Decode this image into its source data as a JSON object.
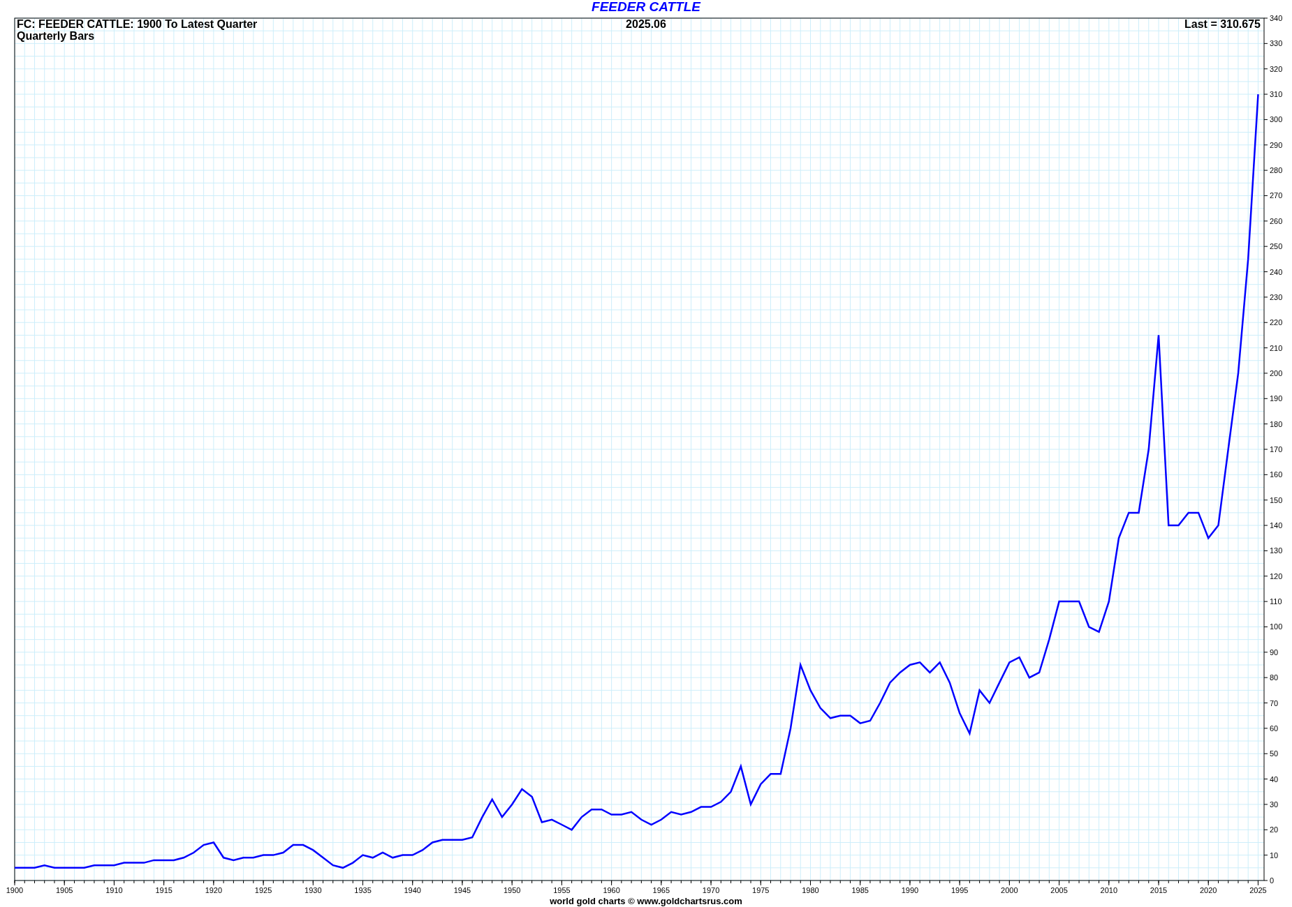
{
  "title": "FEEDER CATTLE",
  "header": {
    "left_lines": [
      "FC: FEEDER CATTLE: 1900 To Latest Quarter",
      "Quarterly Bars"
    ],
    "center": "2025.06",
    "right": "Last = 310.675"
  },
  "chart_data": {
    "type": "line",
    "x": [
      1900,
      1901,
      1902,
      1903,
      1904,
      1905,
      1906,
      1907,
      1908,
      1909,
      1910,
      1911,
      1912,
      1913,
      1914,
      1915,
      1916,
      1917,
      1918,
      1919,
      1920,
      1921,
      1922,
      1923,
      1924,
      1925,
      1926,
      1927,
      1928,
      1929,
      1930,
      1931,
      1932,
      1933,
      1934,
      1935,
      1936,
      1937,
      1938,
      1939,
      1940,
      1941,
      1942,
      1943,
      1944,
      1945,
      1946,
      1947,
      1948,
      1949,
      1950,
      1951,
      1952,
      1953,
      1954,
      1955,
      1956,
      1957,
      1958,
      1959,
      1960,
      1961,
      1962,
      1963,
      1964,
      1965,
      1966,
      1967,
      1968,
      1969,
      1970,
      1971,
      1972,
      1973,
      1974,
      1975,
      1976,
      1977,
      1978,
      1979,
      1980,
      1981,
      1982,
      1983,
      1984,
      1985,
      1986,
      1987,
      1988,
      1989,
      1990,
      1991,
      1992,
      1993,
      1994,
      1995,
      1996,
      1997,
      1998,
      1999,
      2000,
      2001,
      2002,
      2003,
      2004,
      2005,
      2006,
      2007,
      2008,
      2009,
      2010,
      2011,
      2012,
      2013,
      2014,
      2015,
      2016,
      2017,
      2018,
      2019,
      2020,
      2021,
      2022,
      2023,
      2024,
      2025
    ],
    "grid": true,
    "series": [
      {
        "color": "#0000ff",
        "values": [
          5,
          5,
          5,
          6,
          5,
          5,
          5,
          5,
          6,
          6,
          6,
          7,
          7,
          7,
          8,
          8,
          8,
          9,
          11,
          14,
          15,
          9,
          8,
          9,
          9,
          10,
          10,
          11,
          14,
          14,
          12,
          9,
          6,
          5,
          7,
          10,
          9,
          11,
          9,
          10,
          10,
          12,
          15,
          16,
          16,
          16,
          17,
          25,
          32,
          25,
          30,
          36,
          33,
          23,
          24,
          22,
          20,
          25,
          28,
          28,
          26,
          26,
          27,
          24,
          22,
          24,
          27,
          26,
          27,
          29,
          29,
          31,
          35,
          45,
          30,
          38,
          42,
          42,
          60,
          85,
          75,
          68,
          64,
          65,
          65,
          62,
          63,
          70,
          78,
          82,
          85,
          86,
          82,
          86,
          78,
          66,
          58,
          75,
          70,
          78,
          86,
          88,
          80,
          82,
          95,
          110,
          110,
          110,
          100,
          98,
          110,
          135,
          145,
          145,
          170,
          215,
          140,
          140,
          145,
          145,
          135,
          140,
          170,
          200,
          245,
          310
        ]
      }
    ],
    "xlim": [
      1900,
      2025.6
    ],
    "ylim": [
      0,
      340
    ],
    "xticks": [
      1900,
      1905,
      1910,
      1915,
      1920,
      1925,
      1930,
      1935,
      1940,
      1945,
      1950,
      1955,
      1960,
      1965,
      1970,
      1975,
      1980,
      1985,
      1990,
      1995,
      2000,
      2005,
      2010,
      2015,
      2020,
      2025
    ],
    "yticks": [
      0,
      10,
      20,
      30,
      40,
      50,
      60,
      70,
      80,
      90,
      100,
      110,
      120,
      130,
      140,
      150,
      160,
      170,
      180,
      190,
      200,
      210,
      220,
      230,
      240,
      250,
      260,
      270,
      280,
      290,
      300,
      310,
      320,
      330,
      340
    ]
  },
  "footer": "world gold charts © www.goldchartsrus.com"
}
